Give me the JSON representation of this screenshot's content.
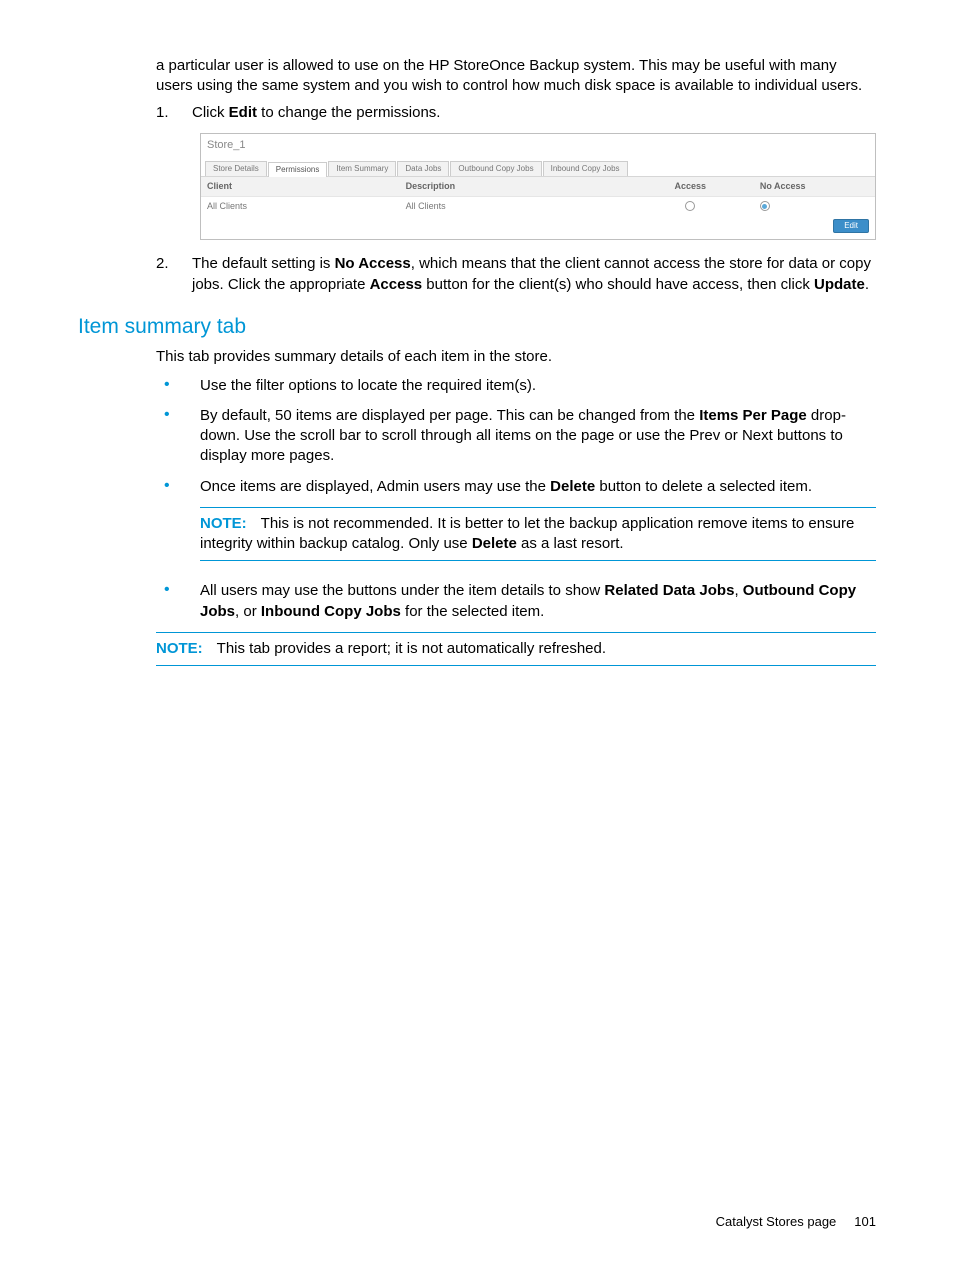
{
  "intro": {
    "para": "a particular user is allowed to use on the HP StoreOnce Backup system. This may be useful with many users using the same system and you wish to control how much disk space is available to individual users."
  },
  "steps": {
    "s1_num": "1.",
    "s1_a": "Click ",
    "s1_b": "Edit",
    "s1_c": " to change the permissions.",
    "s2_num": "2.",
    "s2_a": "The default setting is ",
    "s2_b": "No Access",
    "s2_c": ", which means that the client cannot access the store for data or copy jobs. Click the appropriate ",
    "s2_d": "Access",
    "s2_e": " button for the client(s) who should have access, then click ",
    "s2_f": "Update",
    "s2_g": "."
  },
  "panel": {
    "title": "Store_1",
    "tabs": {
      "t0": "Store Details",
      "t1": "Permissions",
      "t2": "Item Summary",
      "t3": "Data Jobs",
      "t4": "Outbound Copy Jobs",
      "t5": "Inbound Copy Jobs"
    },
    "head": {
      "client": "Client",
      "desc": "Description",
      "access": "Access",
      "noaccess": "No Access"
    },
    "row": {
      "client": "All Clients",
      "desc": "All Clients"
    },
    "edit": "Edit"
  },
  "section": {
    "heading": "Item summary tab",
    "intro": "This tab provides summary details of each item in the store.",
    "b1": "Use the filter options to locate the required item(s).",
    "b2_a": "By default, 50 items are displayed per page. This can be changed from the ",
    "b2_b": "Items Per Page",
    "b2_c": " drop-down. Use the scroll bar to scroll through all items on the page or use the Prev or Next buttons to display more pages.",
    "b3_a": "Once items are displayed, Admin users may use the ",
    "b3_b": "Delete",
    "b3_c": " button to delete a selected item.",
    "note1_label": "NOTE:",
    "note1_a": "This is not recommended. It is better to let the backup application remove items to ensure integrity within backup catalog. Only use ",
    "note1_b": "Delete",
    "note1_c": " as a last resort.",
    "b4_a": "All users may use the buttons under the item details to show ",
    "b4_b": "Related Data Jobs",
    "b4_c": ", ",
    "b4_d": "Outbound Copy Jobs",
    "b4_e": ", or ",
    "b4_f": "Inbound Copy Jobs",
    "b4_g": " for the selected item.",
    "note2_label": "NOTE:",
    "note2": "This tab provides a report; it is not automatically refreshed."
  },
  "footer": {
    "title": "Catalyst Stores page",
    "page": "101"
  }
}
